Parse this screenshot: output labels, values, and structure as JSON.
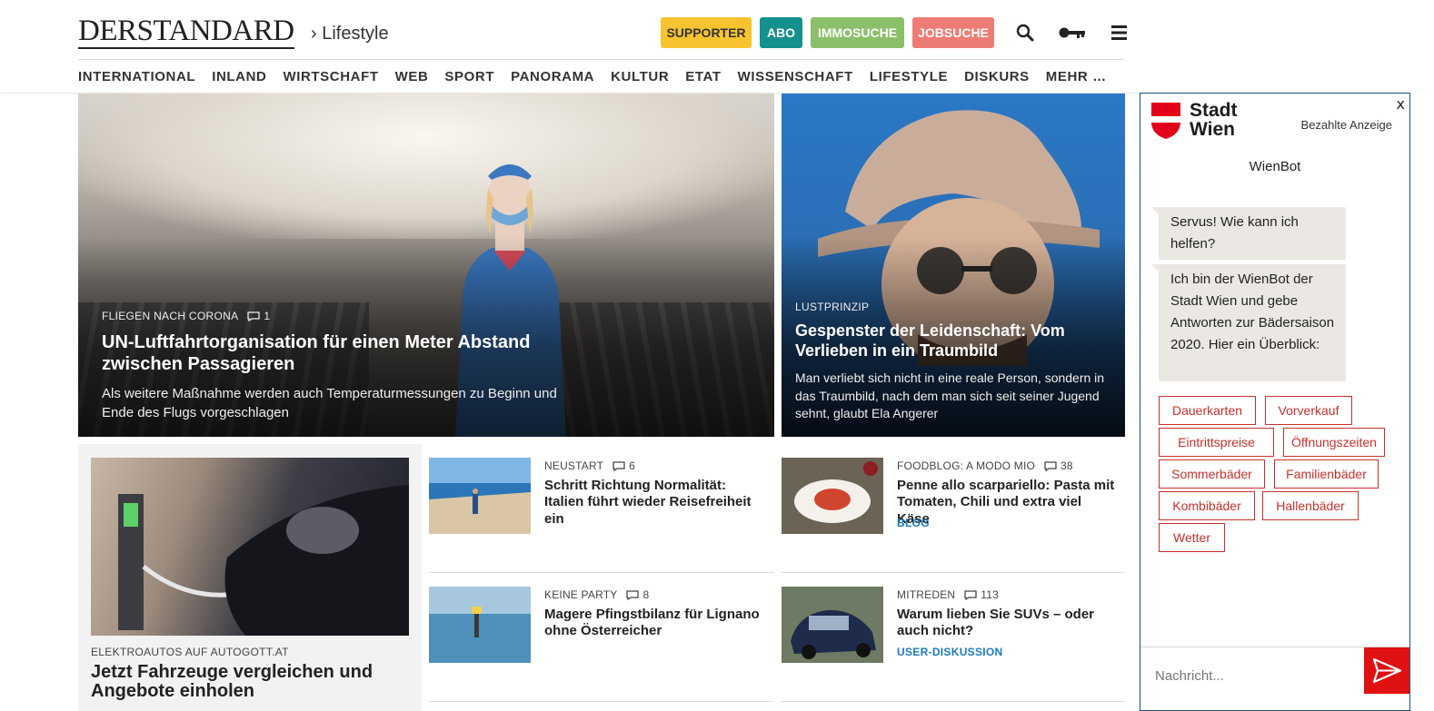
{
  "header": {
    "logo": "DERSTANDARD",
    "section": "› Lifestyle",
    "buttons": {
      "supporter": "SUPPORTER",
      "abo": "ABO",
      "immosuche": "IMMOSUCHE",
      "jobsuche": "JOBSUCHE"
    },
    "icons": [
      "search-icon",
      "key-icon",
      "menu-icon"
    ]
  },
  "nav": [
    "INTERNATIONAL",
    "INLAND",
    "WIRTSCHAFT",
    "WEB",
    "SPORT",
    "PANORAMA",
    "KULTUR",
    "ETAT",
    "WISSENSCHAFT",
    "LIFESTYLE",
    "DISKURS",
    "MEHR …"
  ],
  "hero": [
    {
      "kicker": "FLIEGEN NACH CORONA",
      "comments": "1",
      "title": "UN-Luftfahrtorganisation für einen Meter Abstand zwischen Passagieren",
      "teaser": "Als weitere Maßnahme werden auch Temperaturmessungen zu Beginn und Ende des Flugs vorgeschlagen"
    },
    {
      "kicker": "LUSTPRINZIP",
      "title": "Gespenster der Leidenschaft: Vom Verlieben in ein Traumbild",
      "teaser": "Man verliebt sich nicht in eine reale Person, sondern in das Traumbild, nach dem man sich seit seiner Jugend sehnt, glaubt Ela Angerer"
    }
  ],
  "promo": {
    "kicker": "ELEKTROAUTOS AUF AUTOGOTT.AT",
    "title": "Jetzt Fahrzeuge vergleichen und Angebote einholen"
  },
  "cards": [
    {
      "kicker": "NEUSTART",
      "comments": "6",
      "title": "Schritt Richtung Normalität: Italien führt wieder Reisefreiheit ein",
      "tag": ""
    },
    {
      "kicker": "FOODBLOG: A MODO MIO",
      "comments": "38",
      "title": "Penne allo scarpariello: Pasta mit Tomaten, Chili und extra viel Käse",
      "tag": "BLOG"
    },
    {
      "kicker": "KEINE PARTY",
      "comments": "8",
      "title": "Magere Pfingstbilanz für Lignano ohne Österreicher",
      "tag": ""
    },
    {
      "kicker": "MITREDEN",
      "comments": "113",
      "title": "Warum lieben Sie SUVs – oder auch nicht?",
      "tag": "USER-DISKUSSION"
    }
  ],
  "ad": {
    "close": "x",
    "brand_line1": "Stadt",
    "brand_line2": "Wien",
    "paid": "Bezahlte Anzeige",
    "title": "WienBot",
    "messages": [
      "Servus! Wie kann ich helfen?",
      "Ich bin der WienBot der Stadt Wien und gebe Antworten zur Bädersaison 2020. Hier ein Überblick:"
    ],
    "chips": [
      "Dauerkarten",
      "Vorverkauf",
      "Eintrittspreise",
      "Öffnungszeiten",
      "Sommerbäder",
      "Familienbäder",
      "Kombibäder",
      "Hallenbäder",
      "Wetter"
    ],
    "input_placeholder": "Nachricht...",
    "accent_color": "#e01111"
  },
  "colors": {
    "supporter": "#f7c32e",
    "abo": "#14908d",
    "immosuche": "#8cbf6a",
    "jobsuche": "#ef7c74",
    "tag_blue": "#1a7bc0"
  }
}
